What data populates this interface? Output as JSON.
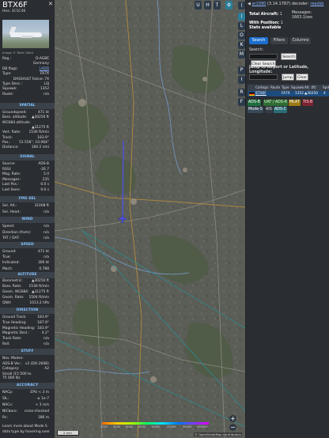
{
  "info_panel": {
    "callsign": "BTX6F",
    "hex_line": "Hex:  3C5C46",
    "close_label": "✕",
    "photo_credit": "Image © Teller Zbild",
    "registration_rows": [
      {
        "label": "Reg.:",
        "value": "D-AGBE"
      },
      {
        "label": "",
        "value": "Germany"
      },
      {
        "label": "DB flags:",
        "value": "LADD"
      },
      {
        "label": "Type:",
        "value": "FA7X"
      },
      {
        "label": "",
        "value": "DASSAULT Falcon 7X"
      },
      {
        "label": "Type Desc.:",
        "value": "L3J"
      },
      {
        "label": "Squawk:",
        "value": "1352"
      },
      {
        "label": "Route:",
        "value": "n/a"
      }
    ],
    "spatial_header": "SPATIAL",
    "spatial_rows": [
      {
        "label": "Groundspeed:",
        "value": "471 kt"
      },
      {
        "label": "Baro. altitude:",
        "value": "▲30250 ft"
      },
      {
        "label": "WGS84 altitude:",
        "value": ""
      },
      {
        "label": "",
        "value": "▲31275 ft"
      },
      {
        "label": "Vert. Rate:",
        "value": "1536 ft/min"
      },
      {
        "label": "Track:",
        "value": "183.9°"
      },
      {
        "label": "Pos.:",
        "value": "51.558°, 10.064°"
      },
      {
        "label": "Distance:",
        "value": "180.2 nmi"
      }
    ],
    "signal_header": "SIGNAL",
    "signal_rows": [
      {
        "label": "Source:",
        "value": "ADS-B"
      },
      {
        "label": "RSSI:",
        "value": "-26.7"
      },
      {
        "label": "Msg. Rate:",
        "value": "5.0"
      },
      {
        "label": "Messages:",
        "value": "235"
      },
      {
        "label": "Last Pos.:",
        "value": "0.0 s"
      },
      {
        "label": "Last Seen:",
        "value": "0.0 s"
      }
    ],
    "fms_header": "FMS SEL",
    "fms_rows": [
      {
        "label": "Sel. Alt.:",
        "value": "31008 ft"
      },
      {
        "label": "Sel. Head.:",
        "value": "n/a"
      }
    ],
    "wind_header": "WIND",
    "wind_rows": [
      {
        "label": "Speed:",
        "value": "n/a"
      },
      {
        "label": "Direction (from):",
        "value": "n/a"
      },
      {
        "label": "TAT / OAT:",
        "value": "n/a"
      }
    ],
    "speed_header": "SPEED",
    "speed_rows": [
      {
        "label": "Ground:",
        "value": "471 kt"
      },
      {
        "label": "True:",
        "value": "n/a"
      },
      {
        "label": "Indicated:",
        "value": "300 kt"
      },
      {
        "label": "Mach:",
        "value": "0.788"
      }
    ],
    "altitude_header": "ALTITUDE",
    "altitude_rows": [
      {
        "label": "Barometric:",
        "value": "▲30250 ft"
      },
      {
        "label": "Baro. Rate:",
        "value": "1536 ft/min"
      },
      {
        "label": "Geom. WGS84:",
        "value": "▲31275 ft"
      },
      {
        "label": "Geom. Rate:",
        "value": "1504 ft/min"
      },
      {
        "label": "QNH:",
        "value": "1013.2 hPa"
      }
    ],
    "direction_header": "DIRECTION",
    "direction_rows": [
      {
        "label": "Ground Track:",
        "value": "183.9°"
      },
      {
        "label": "True Heading:",
        "value": "187.9°"
      },
      {
        "label": "Magnetic Heading:",
        "value": "183.9°"
      },
      {
        "label": "Magnetic Decl.:",
        "value": "4.2°"
      },
      {
        "label": "Track Rate:",
        "value": "n/a"
      },
      {
        "label": "Roll:",
        "value": "n/a"
      }
    ],
    "stuff_header": "STUFF",
    "stuff_rows": [
      {
        "label": "Nav. Modes:",
        "value": ""
      },
      {
        "label": "ADS-B Ver.:",
        "value": "v2 (DO-260B)"
      },
      {
        "label": "Category:",
        "value": "A2"
      }
    ],
    "category_desc_1": "Small (15 500 to",
    "category_desc_2": "75 000 lb)",
    "accuracy_header": "ACCURACY",
    "accuracy_rows": [
      {
        "label": "NACp:",
        "value": "EPU < 3 m"
      },
      {
        "label": "SIL:",
        "value": "≤ 1e-7"
      },
      {
        "label": "NACv:",
        "value": "< 3 m/s"
      },
      {
        "label": "NICbaro:",
        "value": "cross-checked"
      },
      {
        "label": "Rc:",
        "value": "186 m"
      }
    ],
    "footer_line1": "Learn more about Mode S",
    "footer_line2": "data type by hovering over"
  },
  "map": {
    "top_buttons": [
      "U",
      "H",
      "T"
    ],
    "scale_label": "2 nmi",
    "attribution": "© OpenStreetMap contributors",
    "zoom_in": "+",
    "zoom_out": "−",
    "altitude_legend": [
      "2000",
      "4000",
      "6000",
      "8000",
      "10000",
      "20000",
      "30000",
      "40000+"
    ]
  },
  "toolbar": {
    "buttons": [
      "⟨",
      "L",
      "O",
      "K",
      "M",
      "P",
      "I",
      "R",
      "F"
    ]
  },
  "sidebar": {
    "version_link": "ar1090",
    "version_text": " (3.14.1787) decoder: ",
    "decoder_link": "readsb",
    "total_label": "Total Aircraft:",
    "total_value": "1",
    "messages_label": "Messages:",
    "messages_value": "1663.1/sec",
    "with_position_label": "With Position:",
    "with_position_value": "1",
    "stats_text": "Stats available",
    "tabs": [
      "Search",
      "Filters",
      "Columns"
    ],
    "search_label": "Search:",
    "search_button": "Search",
    "clear_search_button": "Clear Search",
    "jump_label": "Jump to Airport or Latitude, Longitude:",
    "jump_button": "Jump",
    "clear_button": "Clear",
    "table_headers": [
      "Callsign",
      "Route",
      "Type",
      "Squawk",
      "Alt. (ft)",
      "Spd"
    ],
    "table_row": {
      "callsign": "BTX6F",
      "route": "",
      "type": "FA7X",
      "squawk": "1352",
      "altitude": "▲30250",
      "speed": "4"
    },
    "badges_row1": [
      "ADS-B",
      "UAT / ADS-R",
      "MLAT",
      "TIS-B"
    ],
    "badges_row2": [
      "Mode-S",
      "AIS",
      "ADS-C"
    ]
  }
}
